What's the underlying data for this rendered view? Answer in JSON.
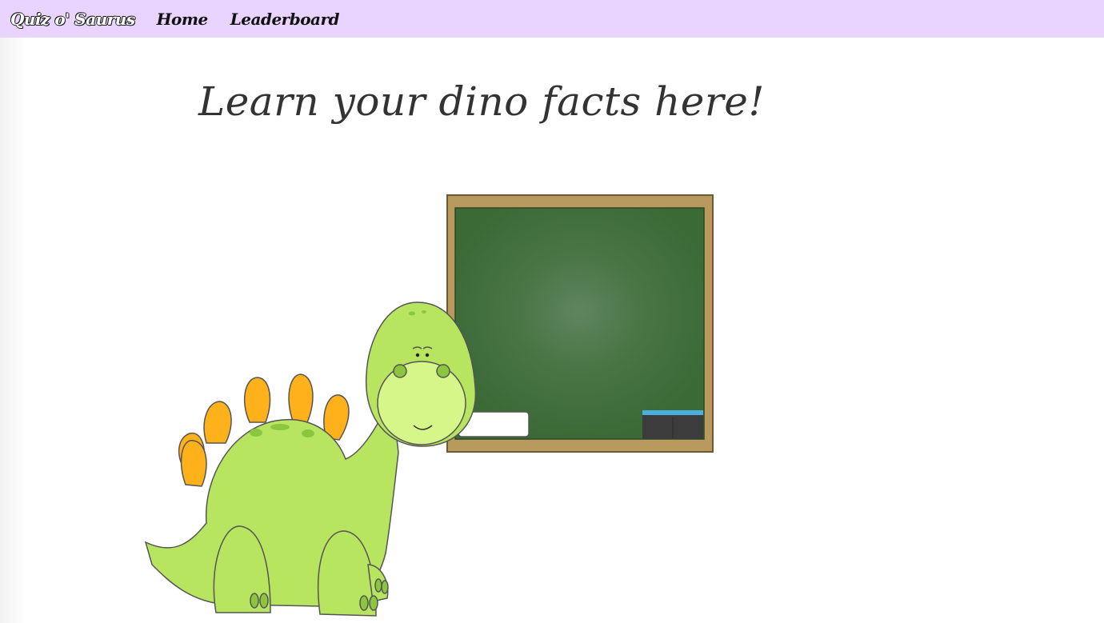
{
  "navbar": {
    "brand": "Quiz o' Saurus",
    "links": [
      {
        "label": "Home"
      },
      {
        "label": "Leaderboard"
      }
    ],
    "background_color": "#e8d4ff"
  },
  "main": {
    "headline": "Learn your dino facts here!"
  },
  "illustration": {
    "subject": "dinosaur-teacher-with-chalkboard",
    "colors": {
      "dino_body": "#b8e55f",
      "dino_belly": "#d6f68a",
      "spikes": "#ffb11b",
      "chalkboard": "#3d6b38",
      "frame": "#b89a5e"
    }
  }
}
